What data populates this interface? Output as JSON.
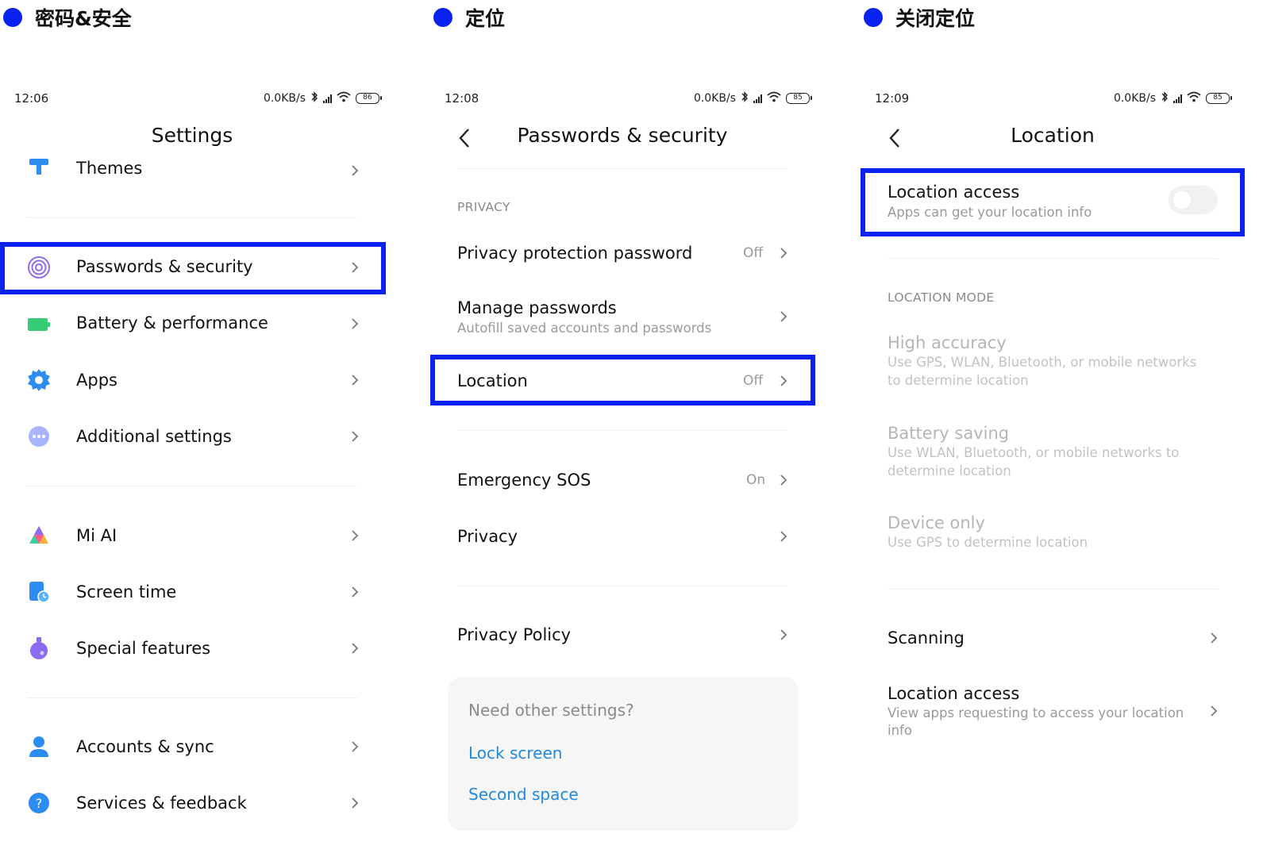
{
  "steps": [
    {
      "title": "密码&安全"
    },
    {
      "title": "定位"
    },
    {
      "title": "关闭定位"
    }
  ],
  "screen1": {
    "status": {
      "time": "12:06",
      "speed": "0.0KB/s",
      "battery": "86"
    },
    "title": "Settings",
    "items": [
      {
        "label": "Themes"
      },
      {
        "label": "Passwords & security"
      },
      {
        "label": "Battery & performance"
      },
      {
        "label": "Apps"
      },
      {
        "label": "Additional settings"
      },
      {
        "label": "Mi AI"
      },
      {
        "label": "Screen time"
      },
      {
        "label": "Special features"
      },
      {
        "label": "Accounts & sync"
      },
      {
        "label": "Services & feedback"
      }
    ]
  },
  "screen2": {
    "status": {
      "time": "12:08",
      "speed": "0.0KB/s",
      "battery": "85"
    },
    "title": "Passwords & security",
    "section_privacy": "PRIVACY",
    "items": [
      {
        "label": "Privacy protection password",
        "value": "Off"
      },
      {
        "label": "Manage passwords",
        "sub": "Autofill saved accounts and passwords"
      },
      {
        "label": "Location",
        "value": "Off"
      },
      {
        "label": "Emergency SOS",
        "value": "On"
      },
      {
        "label": "Privacy"
      },
      {
        "label": "Privacy Policy"
      }
    ],
    "card": {
      "question": "Need other settings?",
      "links": [
        "Lock screen",
        "Second space"
      ]
    }
  },
  "screen3": {
    "status": {
      "time": "12:09",
      "speed": "0.0KB/s",
      "battery": "85"
    },
    "title": "Location",
    "location_access": {
      "label": "Location access",
      "sub": "Apps can get your location info",
      "enabled": false
    },
    "section_mode": "LOCATION MODE",
    "modes": [
      {
        "label": "High accuracy",
        "sub1": "Use GPS, WLAN, Bluetooth, or mobile networks",
        "sub2": "to determine location"
      },
      {
        "label": "Battery saving",
        "sub1": "Use WLAN, Bluetooth, or mobile networks to",
        "sub2": "determine location"
      },
      {
        "label": "Device only",
        "sub1": "Use GPS to determine location"
      }
    ],
    "items": [
      {
        "label": "Scanning"
      },
      {
        "label": "Location access",
        "sub1": "View apps requesting to access your location",
        "sub2": "info"
      }
    ]
  },
  "colors": {
    "accent": "#0a22f0",
    "link": "#2288dd"
  }
}
